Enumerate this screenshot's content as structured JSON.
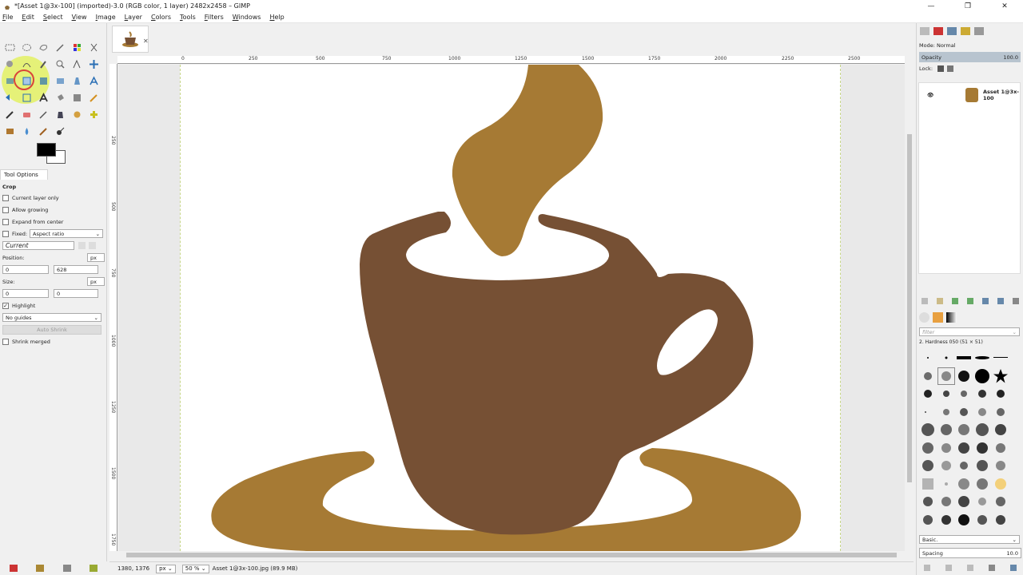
{
  "window": {
    "title": "*[Asset 1@3x-100] (imported)-3.0 (RGB color, 1 layer) 2482x2458 – GIMP",
    "buttons": [
      "—",
      "❐",
      "✕"
    ]
  },
  "menu": [
    "File",
    "Edit",
    "Select",
    "View",
    "Image",
    "Layer",
    "Colors",
    "Tools",
    "Filters",
    "Windows",
    "Help"
  ],
  "tool_options": {
    "tab_label": "Tool Options",
    "tool_name": "Crop",
    "current_layer_only": "Current layer only",
    "allow_growing": "Allow growing",
    "expand_from_center": "Expand from center",
    "fixed_label": "Fixed:",
    "fixed_value": "Aspect ratio",
    "ratio_value": "Current",
    "position_label": "Position:",
    "position_unit": "px",
    "position_x": "0",
    "position_y": "628",
    "size_label": "Size:",
    "size_unit": "px",
    "size_w": "0",
    "size_h": "0",
    "highlight": "Highlight",
    "guides": "No guides",
    "auto_shrink": "Auto Shrink",
    "shrink_merged": "Shrink merged"
  },
  "rulers": {
    "top": [
      "0",
      "250",
      "500",
      "750",
      "1000",
      "1250",
      "1500",
      "1750",
      "2000",
      "2250",
      "2500"
    ],
    "left": [
      "250",
      "500",
      "750",
      "1000",
      "1250",
      "1500",
      "1750"
    ]
  },
  "status": {
    "coords": "1380, 1376",
    "unit": "px",
    "zoom": "50 %",
    "file_info": "Asset 1@3x-100.jpg (89.9 MB)"
  },
  "layers": {
    "mode_label": "Mode: Normal",
    "opacity_label": "Opacity",
    "opacity_value": "100.0",
    "lock_label": "Lock:",
    "layer_name": "Asset 1@3x-100"
  },
  "brushes": {
    "filter_placeholder": "filter",
    "current_brush": "2. Hardness 050 (51 × 51)",
    "preset": "Basic.",
    "spacing_label": "Spacing",
    "spacing_value": "10.0"
  },
  "colors": {
    "cup": "#765034",
    "steam": "#a67a34",
    "saucer": "#a67a34",
    "highlight_ring": "#e2f250"
  }
}
